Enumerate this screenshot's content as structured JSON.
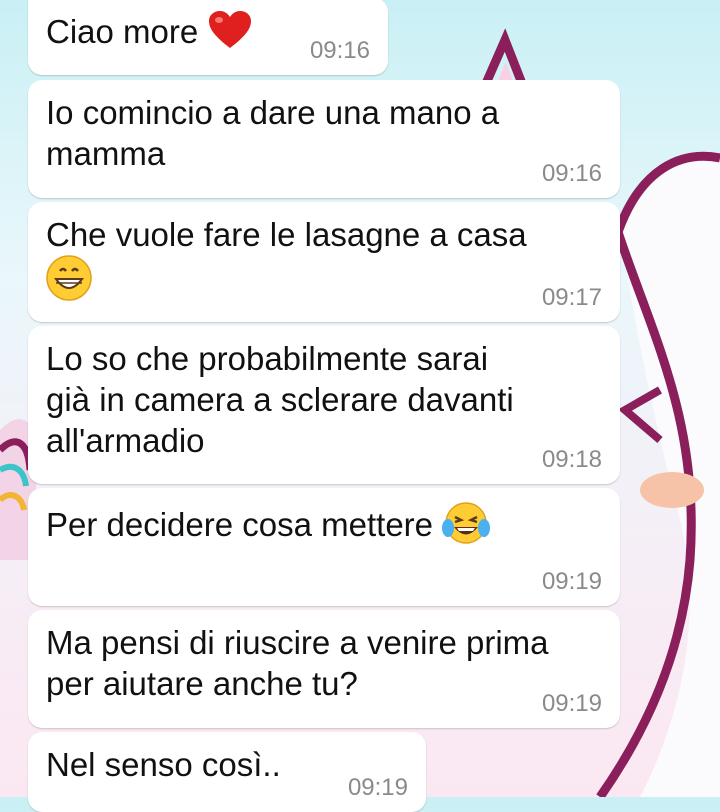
{
  "messages": [
    {
      "text": "Ciao more",
      "emoji": "heart",
      "time": "09:16"
    },
    {
      "text": "Io comincio a dare una mano a\nmamma",
      "time": "09:16"
    },
    {
      "text": "Che vuole fare le lasagne a casa",
      "emoji": "grinning-face",
      "time": "09:17"
    },
    {
      "text": "Lo so che probabilmente sarai\ngià in camera a sclerare davanti\nall'armadio",
      "time": "09:18"
    },
    {
      "text": "Per decidere cosa mettere",
      "emoji": "tears-of-joy",
      "time": "09:19"
    },
    {
      "text": "Ma pensi di riuscire a venire prima\nper aiutare anche tu?",
      "time": "09:19"
    },
    {
      "text": "Nel senso così..",
      "time": "09:19"
    }
  ]
}
